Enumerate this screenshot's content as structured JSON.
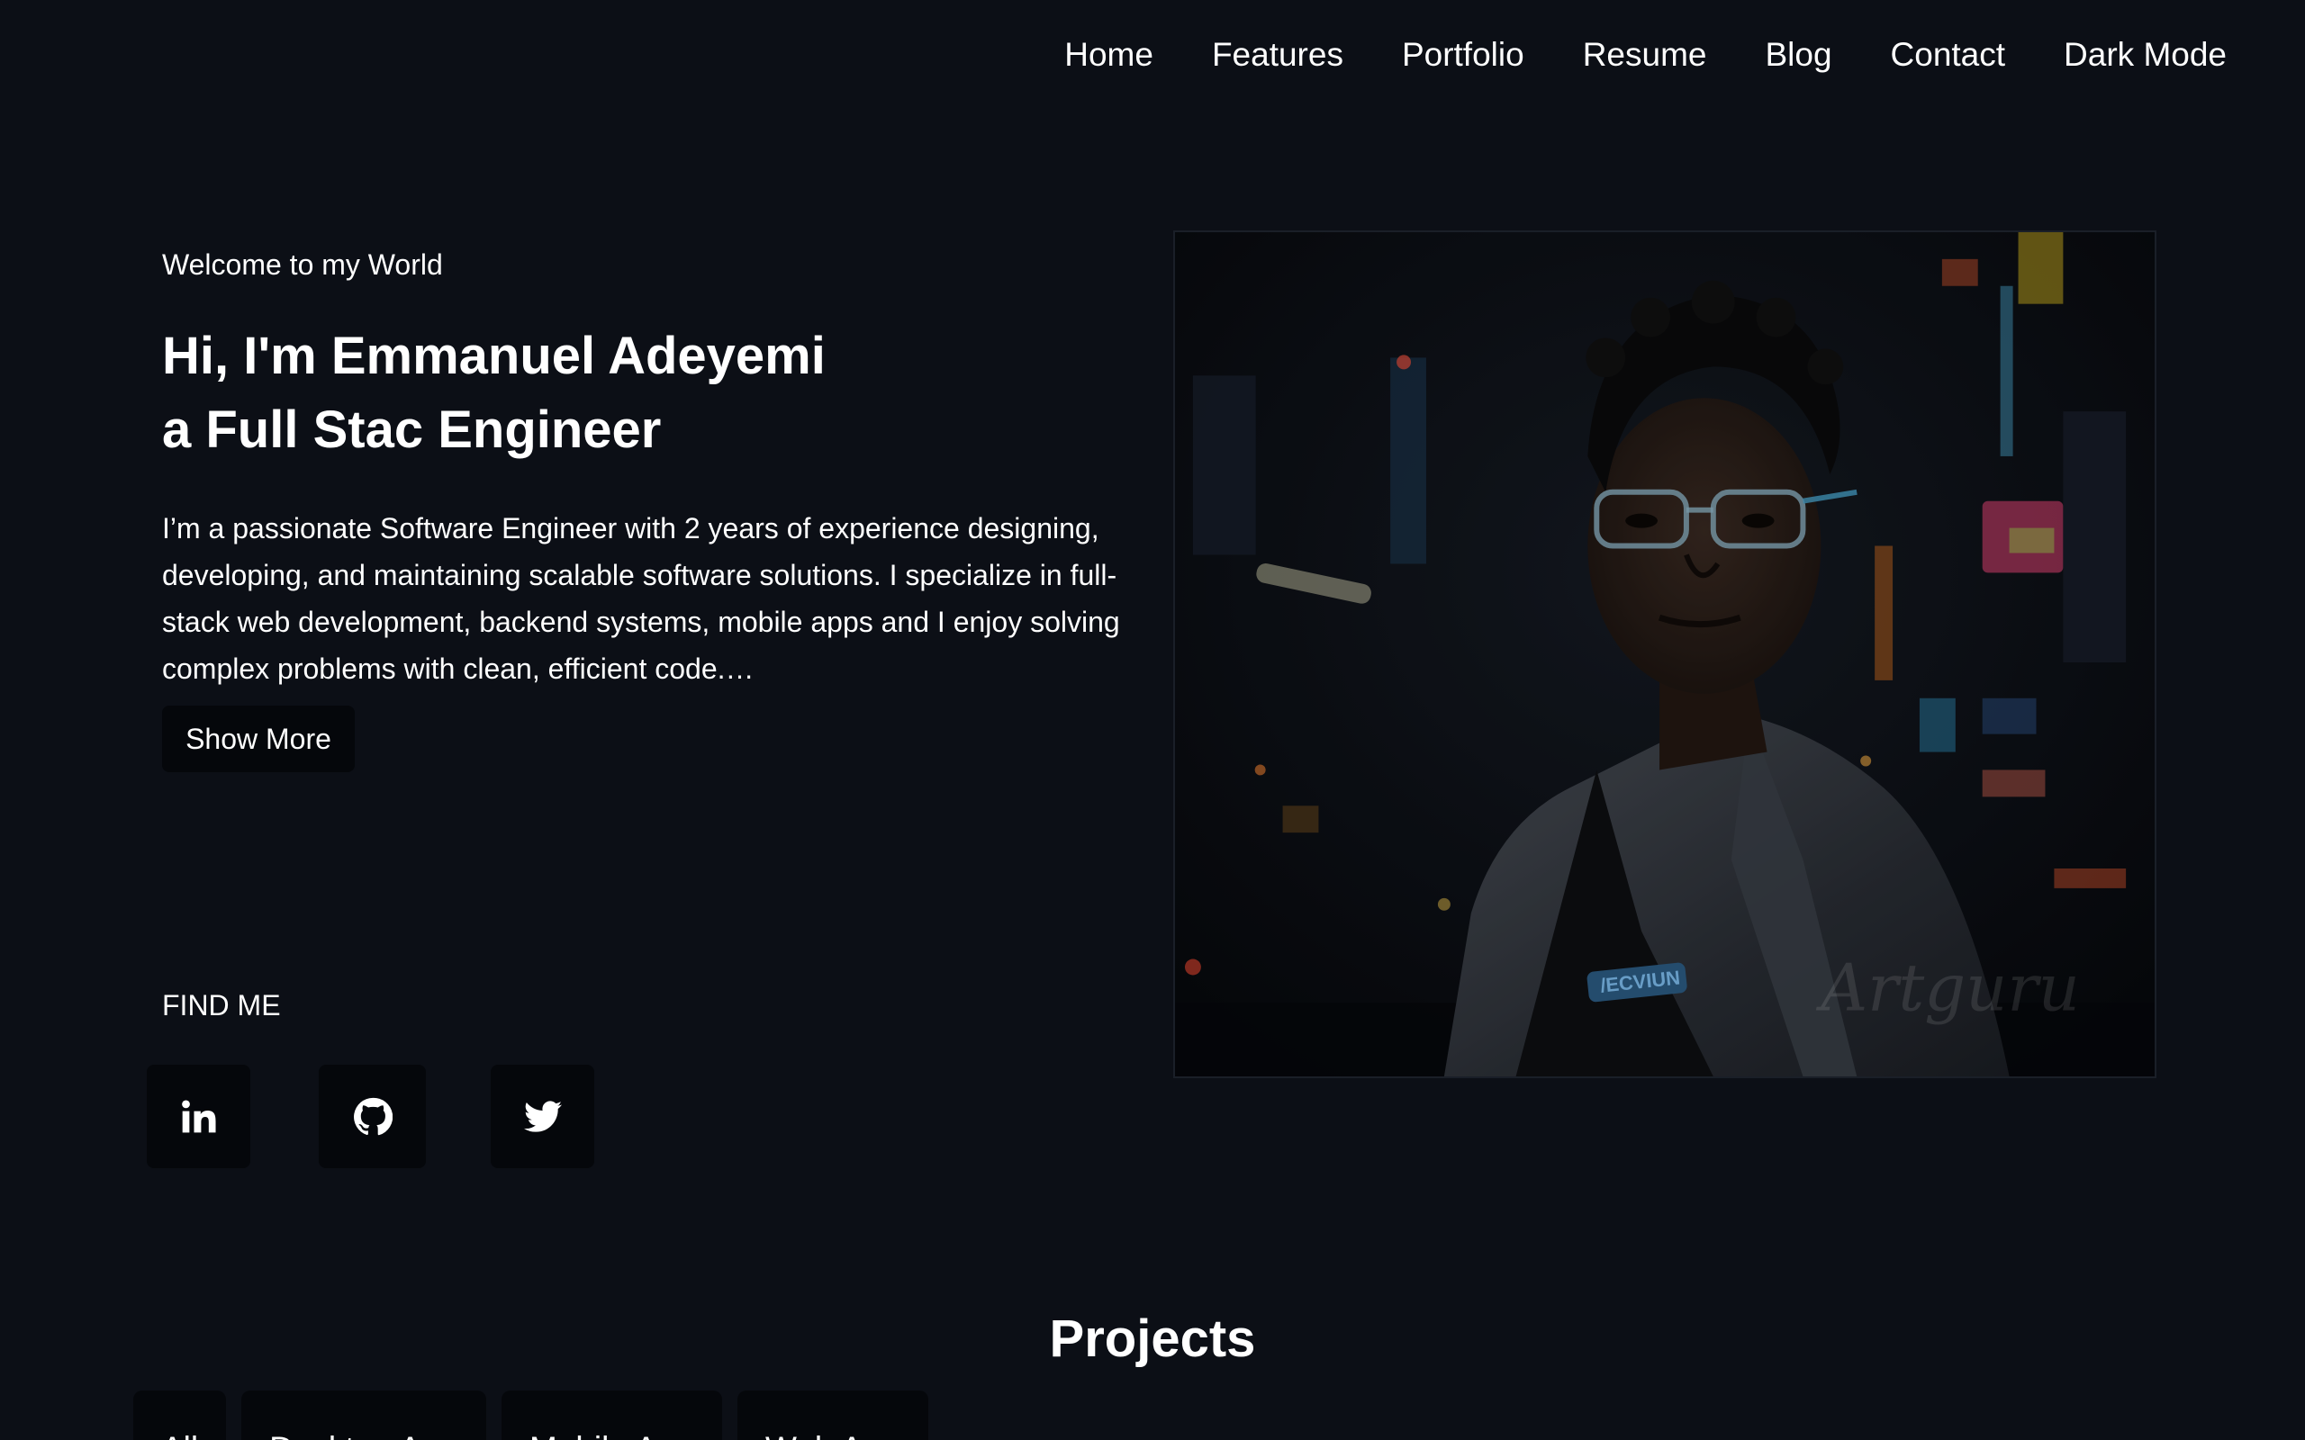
{
  "nav": {
    "items": [
      "Home",
      "Features",
      "Portfolio",
      "Resume",
      "Blog",
      "Contact",
      "Dark Mode"
    ]
  },
  "hero": {
    "welcome": "Welcome to my World",
    "headline_line1": "Hi, I'm Emmanuel Adeyemi",
    "headline_line2": "a Full Stac Engineer",
    "bio": "I’m a passionate Software Engineer with 2 years of experience designing, developing, and maintaining scalable software solutions. I specialize in full-stack web development, backend systems, mobile apps and I enjoy solving complex problems with clean, efficient code.…",
    "show_more_label": "Show More"
  },
  "find_me": {
    "label": "FIND ME",
    "icons": [
      "linkedin-icon",
      "github-icon",
      "twitter-icon"
    ]
  },
  "portrait": {
    "watermark": "Artguru",
    "badge_text": "/ECVIUN"
  },
  "projects": {
    "title": "Projects",
    "filters": [
      "All",
      "Desktop App",
      "Mobile App",
      "Web App"
    ]
  },
  "colors": {
    "background": "#0c0f16",
    "button": "#05070b",
    "text": "#ffffff"
  }
}
